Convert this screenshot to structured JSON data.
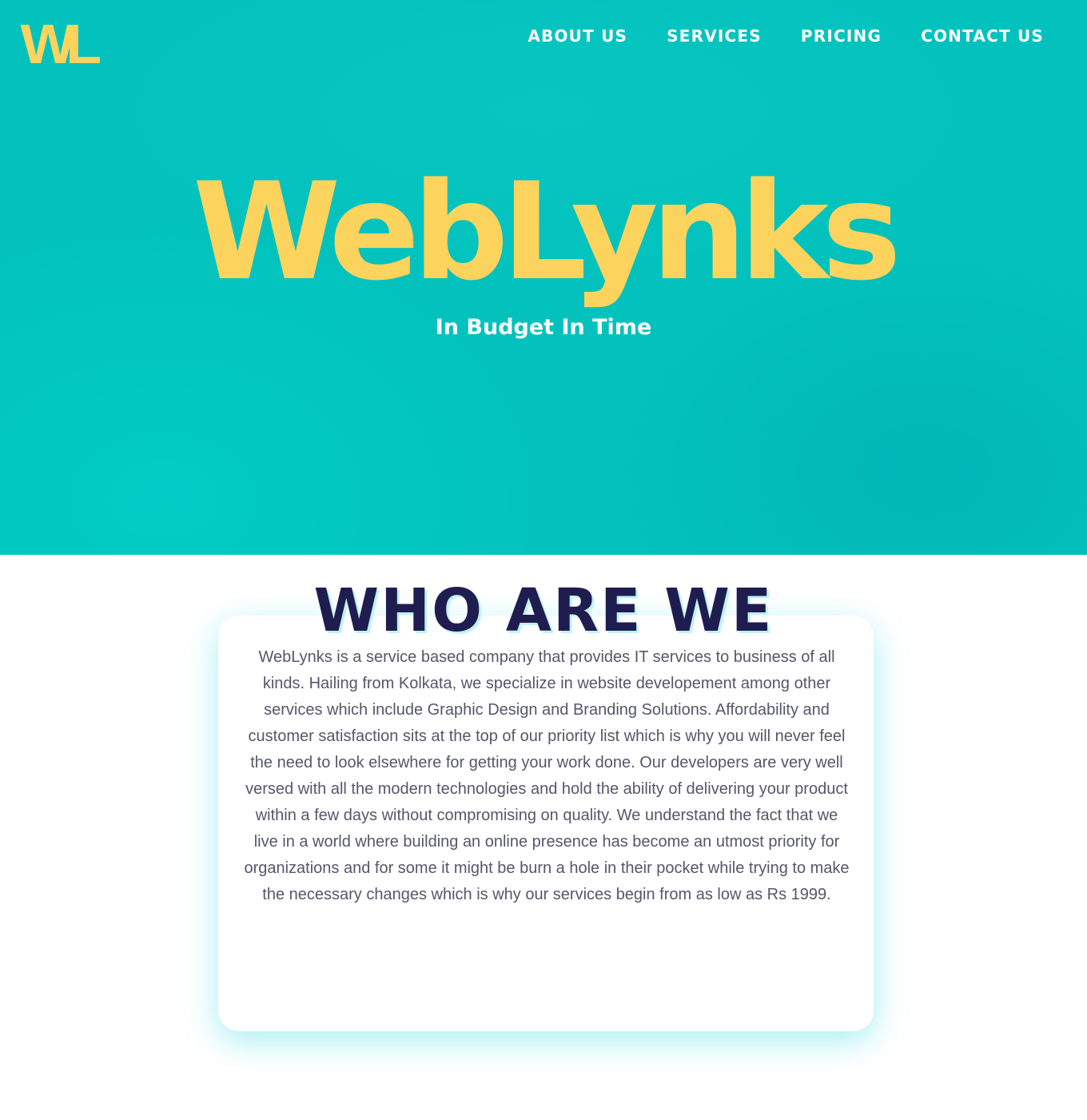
{
  "header": {
    "logo_text": "WL",
    "nav": [
      {
        "label": "ABOUT US"
      },
      {
        "label": "SERVICES"
      },
      {
        "label": "PRICING"
      },
      {
        "label": "CONTACT US"
      }
    ]
  },
  "hero": {
    "title": "WebLynks",
    "tagline": "In Budget In Time"
  },
  "about": {
    "title": "WHO ARE WE",
    "body": "WebLynks is a service based company that provides IT services to business of all kinds. Hailing from Kolkata, we specialize in website developement among other services which include Graphic Design and Branding Solutions. Affordability and customer satisfaction sits at the top of our priority list which is why you will never feel the need to look elsewhere for getting your work done. Our developers are very well versed with all the modern technologies and hold the ability of delivering your product within a few days without compromising on quality. We understand the fact that we live in a world where building an online presence has become an utmost priority for organizations and for some it might be burn a hole in their pocket while trying to make the necessary changes which is why our services begin from as low as Rs 1999."
  },
  "colors": {
    "hero_bg": "#03c2bd",
    "brand_yellow": "#fcd35c",
    "heading_navy": "#1f1d4f",
    "body_gray": "#55576a"
  }
}
